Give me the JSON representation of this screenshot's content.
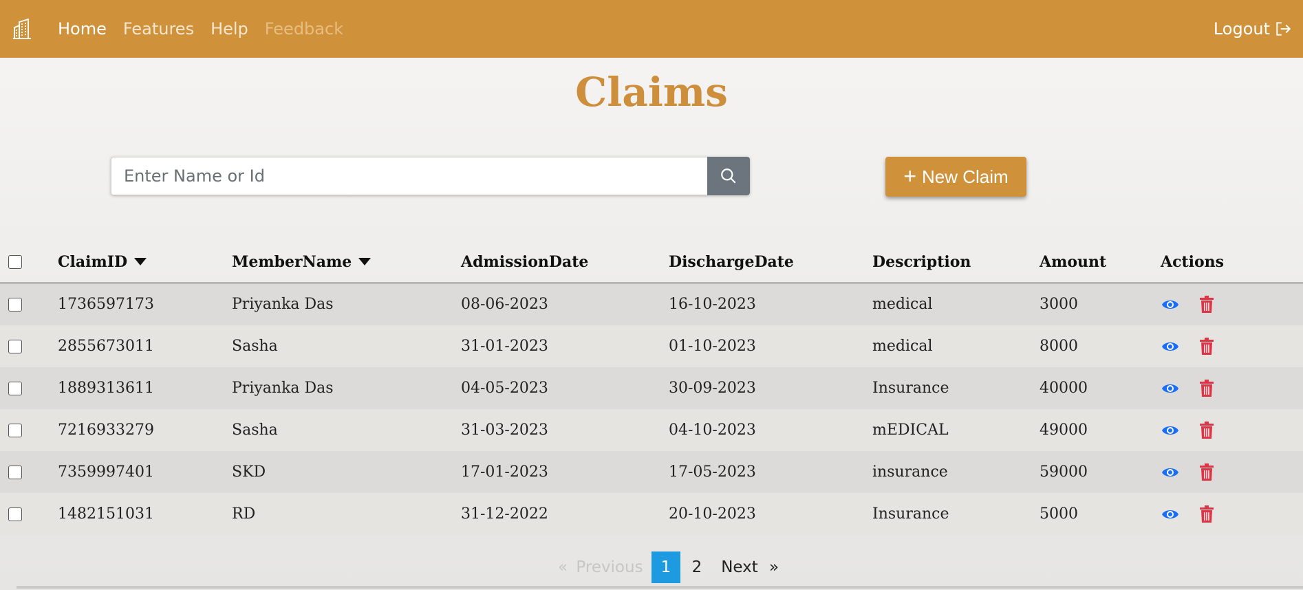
{
  "nav": {
    "brand_icon": "buildings-icon",
    "links": [
      {
        "label": "Home"
      },
      {
        "label": "Features"
      },
      {
        "label": "Help"
      },
      {
        "label": "Feedback"
      }
    ],
    "logout_label": "Logout",
    "accent": "#cf923b"
  },
  "page": {
    "title": "Claims"
  },
  "search": {
    "placeholder": "Enter Name or Id",
    "value": ""
  },
  "new_claim_label": "New Claim",
  "table": {
    "headers": [
      "ClaimID",
      "MemberName",
      "AdmissionDate",
      "DischargeDate",
      "Description",
      "Amount",
      "Actions"
    ],
    "rows": [
      {
        "id": "1736597173",
        "name": "Priyanka Das",
        "admission": "08-06-2023",
        "discharge": "16-10-2023",
        "description": "medical",
        "amount": "3000"
      },
      {
        "id": "2855673011",
        "name": "Sasha",
        "admission": "31-01-2023",
        "discharge": "01-10-2023",
        "description": "medical",
        "amount": "8000"
      },
      {
        "id": "1889313611",
        "name": "Priyanka Das",
        "admission": "04-05-2023",
        "discharge": "30-09-2023",
        "description": "Insurance",
        "amount": "40000"
      },
      {
        "id": "7216933279",
        "name": "Sasha",
        "admission": "31-03-2023",
        "discharge": "04-10-2023",
        "description": "mEDICAL",
        "amount": "49000"
      },
      {
        "id": "7359997401",
        "name": "SKD",
        "admission": "17-01-2023",
        "discharge": "17-05-2023",
        "description": "insurance",
        "amount": "59000"
      },
      {
        "id": "1482151031",
        "name": "RD",
        "admission": "31-12-2022",
        "discharge": "20-10-2023",
        "description": "Insurance",
        "amount": "5000"
      }
    ]
  },
  "pagination": {
    "first": "«",
    "previous": "Previous",
    "pages": [
      "1",
      "2"
    ],
    "current": "1",
    "next": "Next",
    "last": "»"
  },
  "colors": {
    "view_icon": "#1a6ef5",
    "delete_icon": "#dc3545",
    "page_active": "#1e9be0"
  }
}
